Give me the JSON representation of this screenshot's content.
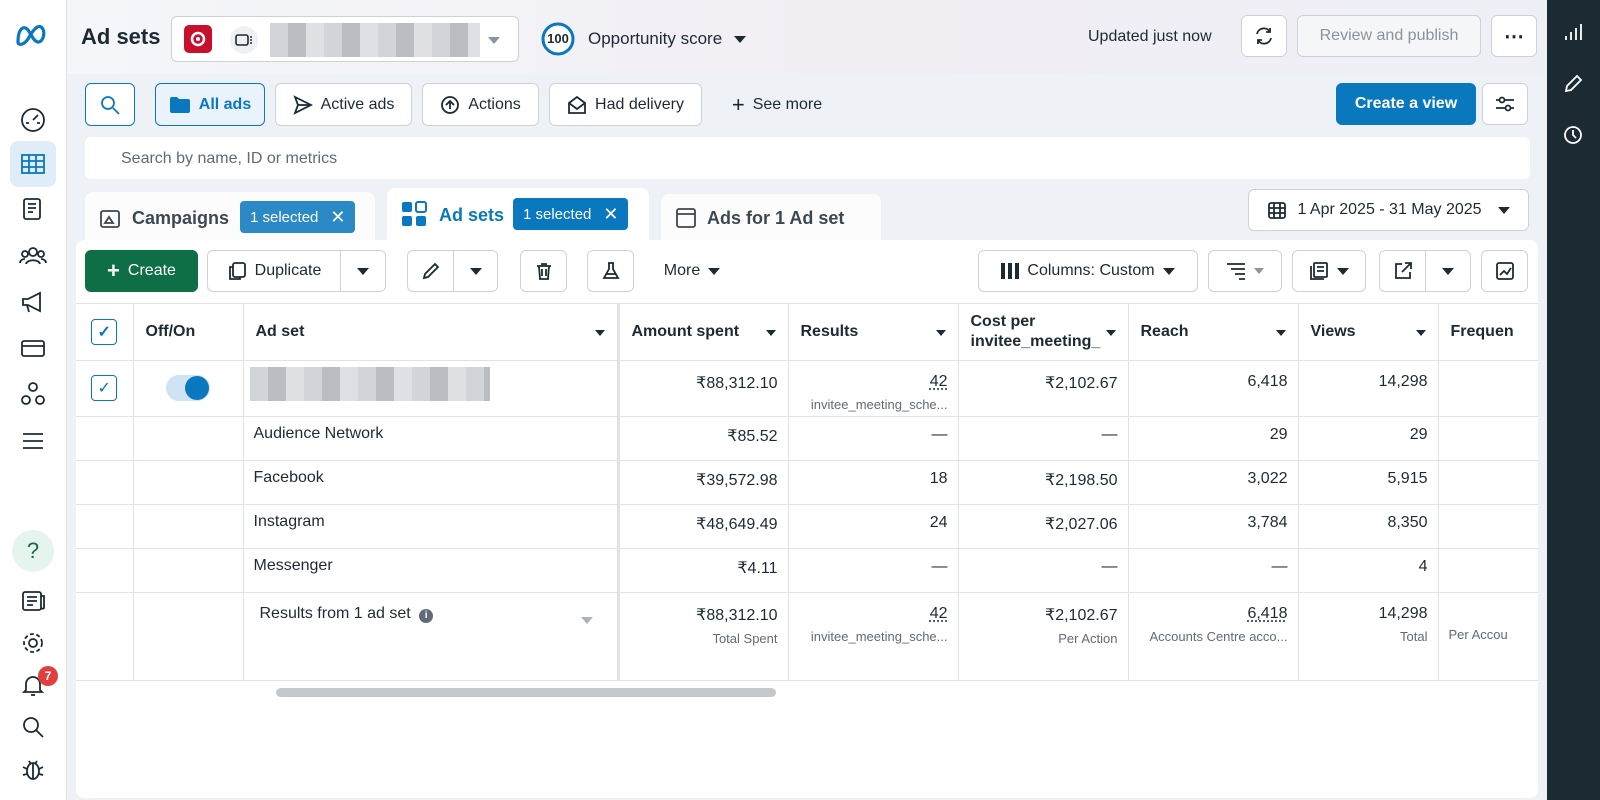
{
  "header": {
    "title": "Ad sets",
    "opportunity_score_value": "100",
    "opportunity_score_label": "Opportunity score",
    "updated_text": "Updated just now",
    "review_publish_label": "Review and publish",
    "more_label": "⋯"
  },
  "filters": {
    "all_ads": "All ads",
    "active_ads": "Active ads",
    "actions": "Actions",
    "had_delivery": "Had delivery",
    "see_more": "See more",
    "create_view": "Create a view",
    "search_placeholder": "Search by name, ID or metrics"
  },
  "tabs": {
    "campaigns": {
      "label": "Campaigns",
      "badge": "1 selected"
    },
    "ad_sets": {
      "label": "Ad sets",
      "badge": "1 selected"
    },
    "ads": {
      "label": "Ads for 1 Ad set"
    }
  },
  "date_range": "1 Apr 2025 - 31 May 2025",
  "toolbar": {
    "create_label": "Create",
    "duplicate_label": "Duplicate",
    "more_label": "More",
    "columns_label": "Columns: Custom"
  },
  "table": {
    "columns": [
      "Off/On",
      "Ad set",
      "Amount spent",
      "Results",
      "Cost per invitee_meeting_",
      "Reach",
      "Views",
      "Frequen"
    ],
    "main_row": {
      "amount_spent": "₹88,312.10",
      "results": "42",
      "results_sub": "invitee_meeting_sche...",
      "cost_per": "₹2,102.67",
      "reach": "6,418",
      "views": "14,298"
    },
    "breakdown_rows": [
      {
        "name": "Audience Network",
        "amount_spent": "₹85.52",
        "results": "—",
        "cost_per": "—",
        "reach": "29",
        "views": "29"
      },
      {
        "name": "Facebook",
        "amount_spent": "₹39,572.98",
        "results": "18",
        "cost_per": "₹2,198.50",
        "reach": "3,022",
        "views": "5,915"
      },
      {
        "name": "Instagram",
        "amount_spent": "₹48,649.49",
        "results": "24",
        "cost_per": "₹2,027.06",
        "reach": "3,784",
        "views": "8,350"
      },
      {
        "name": "Messenger",
        "amount_spent": "₹4.11",
        "results": "—",
        "cost_per": "—",
        "reach": "—",
        "views": "4"
      }
    ],
    "summary": {
      "label": "Results from 1 ad set",
      "amount_spent": "₹88,312.10",
      "amount_spent_sub": "Total Spent",
      "results": "42",
      "results_sub": "invitee_meeting_sche...",
      "cost_per": "₹2,102.67",
      "cost_per_sub": "Per Action",
      "reach": "6,418",
      "reach_sub": "Accounts Centre acco...",
      "views": "14,298",
      "views_sub": "Total",
      "frequency_sub": "Per Accou"
    }
  },
  "notifications_count": "7",
  "colors": {
    "accent": "#0a78be",
    "create_green": "#0e6e46",
    "badge_blue": "#0a78be",
    "notif_red": "#e0403d"
  }
}
